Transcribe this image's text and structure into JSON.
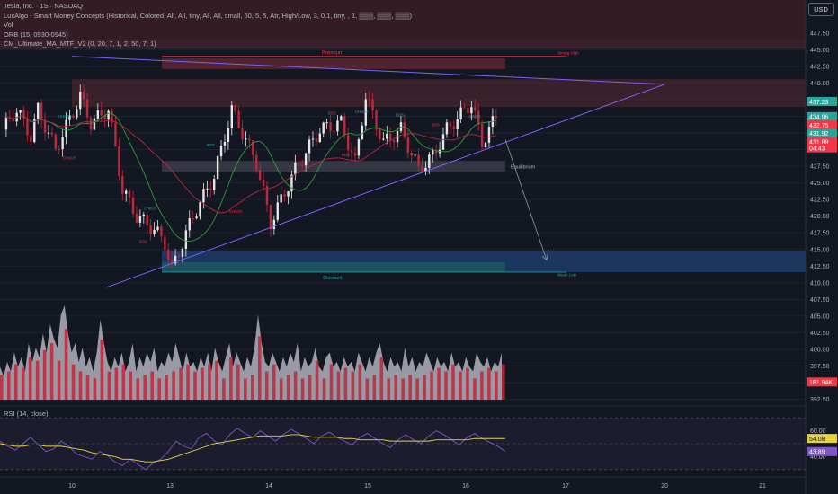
{
  "legend": {
    "symbol": "Tesla, Inc. · 1S · NASDAQ",
    "indicators": [
      "LuxAlgo - Smart Money Concepts (Historical, Colored, All, All, tiny, All, All, small, 50, 5, 5, Atr, High/Low, 3, 0.1, tiny, , 1, ▒▒▒, ▒▒▒, ▒▒▒)",
      "Vol",
      "ORB (15, 0930-0945)",
      "CM_Ultimate_MA_MTF_V2 (0, 20, 7, 1, 2, 50, 7, 1)"
    ]
  },
  "currency_button": "USD",
  "rsi_label": "RSI (14, close)",
  "colors": {
    "background": "#131722",
    "up": "#e6e6e6",
    "down": "#c2263a",
    "premium": "#f23645",
    "discount": "#2962ff",
    "triangle": "#7b61ff",
    "rsi_line": "#7e57c2",
    "rsi_ma": "#e9d33a"
  },
  "chart_data": {
    "type": "candlestick",
    "price_axis": {
      "ticks": [
        "447.50",
        "445.00",
        "442.50",
        "440.00",
        "437.50",
        "435.00",
        "432.50",
        "430.00",
        "427.50",
        "425.00",
        "422.50",
        "420.00",
        "417.50",
        "415.00",
        "412.50",
        "410.00",
        "407.50",
        "405.00",
        "402.50",
        "400.00",
        "397.50",
        "395.00",
        "392.50"
      ],
      "ylim": [
        391.5,
        449.5
      ]
    },
    "date_axis": {
      "ticks": [
        "10",
        "13",
        "14",
        "15",
        "16",
        "17",
        "20",
        "21"
      ]
    },
    "price_labels": [
      {
        "text": "437.23",
        "value": 437.23,
        "color": "#26a69a"
      },
      {
        "text": "434.96",
        "value": 434.96,
        "color": "#26a69a"
      },
      {
        "text": "432.75",
        "value": 433.7,
        "color": "#f23645"
      },
      {
        "text": "431.92",
        "value": 432.45,
        "color": "#26a69a"
      },
      {
        "text": "431.89",
        "value": 431.2,
        "color": "#f23645"
      },
      {
        "text": "04:43",
        "value": 430.25,
        "color": "#f23645"
      },
      {
        "text": "181.94K",
        "value": 395.1,
        "color": "#f23645"
      }
    ],
    "rsi_axis": {
      "ticks": [
        "60.00",
        "40.00"
      ]
    },
    "rsi_labels": [
      {
        "text": "54.08",
        "value": 54.08,
        "color": "#e9d33a"
      },
      {
        "text": "43.89",
        "value": 43.89,
        "color": "#7e57c2"
      }
    ],
    "zone_labels": {
      "premium": "Premium",
      "equilibrium": "Equilibrium",
      "discount": "Discount",
      "strong_high": "Strong High",
      "weak_low": "Weak Low"
    },
    "structure_labels": [
      "CHoCH",
      "CHoCH",
      "BOS",
      "CHoCH",
      "CHoCH",
      "BOS",
      "BOS",
      "BOS",
      "CHoCH",
      "BOS",
      "BOS",
      "CHoCH"
    ],
    "triangle": {
      "apex": [
        20,
        439.8
      ]
    },
    "anchors": [
      [
        0.0,
        433.0
      ],
      [
        0.8,
        436.0
      ],
      [
        1.6,
        432.0
      ],
      [
        2.0,
        436.0
      ],
      [
        3.0,
        430.0
      ],
      [
        4.4,
        438.0
      ],
      [
        5.0,
        434.0
      ],
      [
        6.0,
        436.0
      ],
      [
        6.8,
        424.0
      ],
      [
        7.6,
        420.0
      ],
      [
        8.6,
        418.0
      ],
      [
        9.2,
        416.0
      ],
      [
        9.6,
        412.0
      ],
      [
        10.8,
        420.0
      ],
      [
        12.0,
        426.0
      ],
      [
        13.0,
        436.0
      ],
      [
        14.4,
        428.0
      ],
      [
        15.2,
        419.0
      ],
      [
        16.6,
        427.0
      ],
      [
        18.0,
        433.0
      ],
      [
        19.2,
        434.0
      ],
      [
        20.0,
        428.0
      ],
      [
        20.6,
        438.0
      ],
      [
        21.6,
        431.0
      ],
      [
        22.6,
        433.0
      ],
      [
        23.6,
        427.0
      ],
      [
        24.4,
        429.0
      ],
      [
        25.2,
        433.0
      ],
      [
        26.6,
        437.0
      ],
      [
        27.2,
        431.0
      ],
      [
        28.0,
        435.0
      ]
    ],
    "volume": [
      0.35,
      0.25,
      0.4,
      0.3,
      0.5,
      0.35,
      0.45,
      0.3,
      0.6,
      0.4,
      0.55,
      0.45,
      0.7,
      0.5,
      0.8,
      0.65,
      0.55,
      0.9,
      1.0,
      0.7,
      0.5,
      0.6,
      0.4,
      0.55,
      0.35,
      0.45,
      0.3,
      0.5,
      0.85,
      0.6,
      0.4,
      0.3,
      0.45,
      0.35,
      0.5,
      0.3,
      0.4,
      0.6,
      0.3,
      0.45,
      0.35,
      0.5,
      0.4,
      0.55,
      0.3,
      0.4,
      0.35,
      0.5,
      0.4,
      0.6,
      0.45,
      0.3,
      0.5,
      0.35,
      0.4,
      0.3,
      0.45,
      0.35,
      0.5,
      0.3,
      0.55,
      0.4,
      0.3,
      0.45,
      0.6,
      0.35,
      0.5,
      0.4,
      0.3,
      0.45,
      0.35,
      0.55,
      0.9,
      0.6,
      0.4,
      0.35,
      0.5,
      0.4,
      0.3,
      0.45,
      0.35,
      0.5,
      0.4,
      0.6,
      0.3,
      0.45,
      0.35,
      0.4,
      0.55,
      0.35,
      0.3,
      0.45,
      0.5,
      0.35,
      0.4,
      0.3,
      0.45,
      0.35,
      0.4,
      0.3,
      0.5,
      0.4,
      0.3,
      0.45,
      0.35,
      0.5,
      0.6,
      0.4,
      0.3,
      0.45,
      0.35,
      0.4,
      0.3,
      0.55,
      0.35,
      0.45,
      0.3,
      0.4,
      0.35,
      0.5,
      0.4,
      0.3,
      0.45,
      0.35,
      0.4,
      0.3,
      0.5,
      0.35,
      0.4,
      0.3,
      0.45,
      0.35,
      0.3,
      0.5,
      0.4,
      0.35,
      0.45,
      0.3,
      0.4,
      0.35,
      0.5
    ],
    "rsi_series": [
      52,
      48,
      45,
      50,
      55,
      49,
      44,
      46,
      52,
      48,
      42,
      40,
      38,
      44,
      41,
      36,
      33,
      38,
      34,
      30,
      35,
      38,
      44,
      52,
      48,
      46,
      55,
      58,
      52,
      49,
      57,
      62,
      58,
      55,
      60,
      56,
      52,
      57,
      61,
      58,
      54,
      50,
      56,
      59,
      55,
      52,
      49,
      55,
      58,
      54,
      50,
      47,
      53,
      57,
      53,
      50,
      56,
      60,
      57,
      53,
      49,
      55,
      58,
      54,
      51,
      48,
      44
    ],
    "rsi_ma": [
      50,
      49,
      48,
      48,
      49,
      49,
      48,
      48,
      48,
      47,
      46,
      45,
      43,
      42,
      41,
      40,
      38,
      38,
      37,
      36,
      36,
      37,
      38,
      40,
      42,
      44,
      46,
      48,
      50,
      51,
      52,
      53,
      54,
      55,
      56,
      56,
      56,
      56,
      57,
      57,
      56,
      55,
      55,
      55,
      55,
      54,
      54,
      53,
      53,
      53,
      53,
      52,
      52,
      52,
      52,
      52,
      52,
      53,
      53,
      53,
      53,
      53,
      54,
      54,
      54,
      54,
      54
    ]
  }
}
